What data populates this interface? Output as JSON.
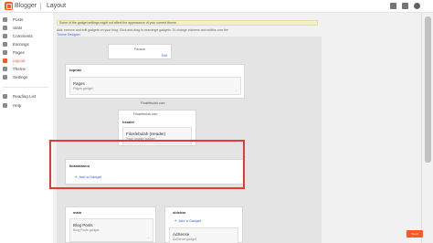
{
  "app": {
    "name": "Blogger",
    "page_title": "Layout"
  },
  "top_icons": [
    "grid-icon",
    "apps-icon",
    "avatar"
  ],
  "sidebar": {
    "items": [
      {
        "label": "Posts",
        "icon": "posts-icon",
        "active": false
      },
      {
        "label": "Stats",
        "icon": "stats-icon",
        "active": false
      },
      {
        "label": "Comments",
        "icon": "comments-icon",
        "active": false
      },
      {
        "label": "Earnings",
        "icon": "earnings-icon",
        "active": false
      },
      {
        "label": "Pages",
        "icon": "pages-icon",
        "active": false
      },
      {
        "label": "Layout",
        "icon": "layout-icon",
        "active": true
      },
      {
        "label": "Theme",
        "icon": "theme-icon",
        "active": false
      },
      {
        "label": "Settings",
        "icon": "settings-icon",
        "active": false
      },
      {
        "label": "Reading List",
        "icon": "reading-list-icon",
        "active": false
      },
      {
        "label": "Help",
        "icon": "help-icon",
        "active": false
      }
    ]
  },
  "main": {
    "warning": "Some of the gadget settings might not affect the appearance of your current theme.",
    "intro": "Add, remove and edit gadgets on your blog. Click and drag to rearrange gadgets. To change columns and widths, use the",
    "intro_link": "Theme Designer",
    "favicon": {
      "label": "Favicon",
      "edit": "Edit"
    },
    "topnav": {
      "title": "topnav",
      "widget_title": "Pages",
      "widget_sub": "Pages gadget"
    },
    "header_section": {
      "label": "Filosfebulah.com",
      "title": "header",
      "small": "Filosfebulah.com",
      "widget_title": "Filosfebulah (Header)",
      "widget_sub": "Page header gadget"
    },
    "iklan": {
      "title": "iklanatasnu",
      "add_gadget": "Add a Gadget"
    },
    "main_col": {
      "title": "main",
      "widget_title": "Blog Posts",
      "widget_sub": "Blog Posts gadget"
    },
    "sidebar_col": {
      "title": "sidebar",
      "add_gadget": "Add a Gadget",
      "widget_title": "AdSense",
      "widget_sub": "AdSense gadget"
    },
    "edit_icon_text": "…"
  },
  "feedback": "Send feedback",
  "colors": {
    "accent": "#ff5722",
    "link": "#3367d6",
    "highlight": "#e53935"
  }
}
